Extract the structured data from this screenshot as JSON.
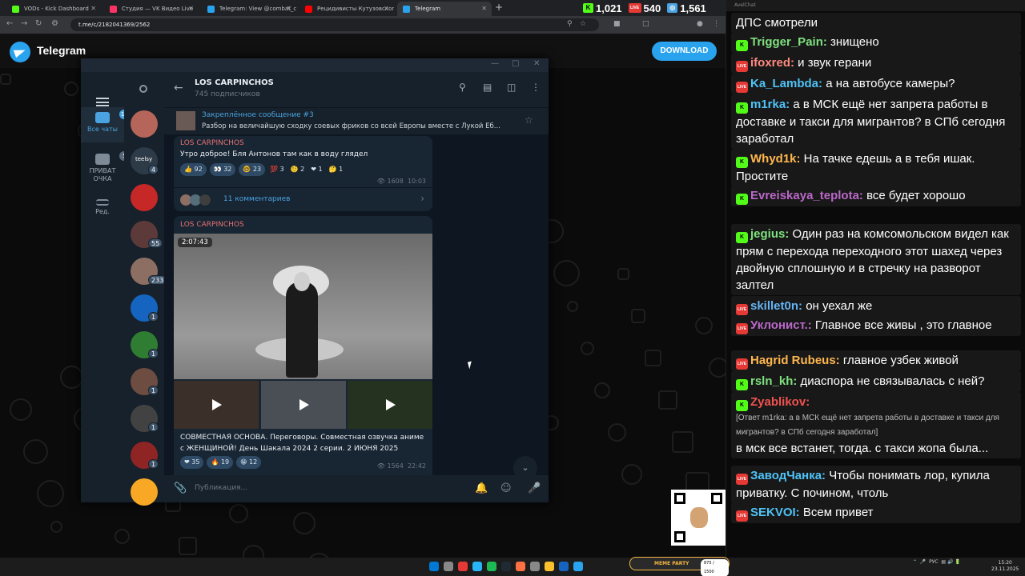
{
  "browser": {
    "tabs": [
      {
        "label": "VODs - Kick Dashboard",
        "color": "#53fc18"
      },
      {
        "label": "Студия — VK Видео Live",
        "color": "#ff3366"
      },
      {
        "label": "Telegram: View @combat_cyperpu",
        "color": "#2aa3ef"
      },
      {
        "label": "Рецидивисты Кутузовского пр...",
        "color": "#ff0000"
      },
      {
        "label": "Telegram",
        "color": "#2aa3ef"
      }
    ],
    "url": "t.me/c/2182041369/2562",
    "new_tab": "+"
  },
  "counters": [
    {
      "icon": "kick-icon",
      "value": "1,021",
      "color": "#53fc18"
    },
    {
      "icon": "live-icon",
      "value": "540",
      "color": "#e53935"
    },
    {
      "icon": "viewers-icon",
      "value": "1,561",
      "color": "#4aa3e0"
    }
  ],
  "telegram": {
    "brand": "Telegram",
    "download": "DOWNLOAD",
    "folders": [
      {
        "label": "Все чаты",
        "badge": "12"
      },
      {
        "label": "ПРИВАТ ОЧКА",
        "badge": "5"
      },
      {
        "label": "Ред.",
        "badge": ""
      }
    ],
    "chat_badges": [
      "4",
      "",
      "55",
      "233",
      "1",
      "1",
      "1",
      "1",
      "1"
    ],
    "avatar_caption": "teelsy",
    "channel": {
      "name": "LOS CARPINCHOS",
      "subs": "745 подписчиков"
    },
    "pinned": {
      "title": "Закреплённое сообщение #3",
      "text": "Разбор на величайшую сходку соевых фриков со всей Европы вместе с Лукой Еб..."
    },
    "msg1": {
      "author": "LOS CARPINCHOS",
      "text": "Утро доброе! Бля Антонов там как в воду глядел",
      "reactions": [
        "👍 92",
        "👀 32",
        "🤓 23",
        "💯 3",
        "🤨 2",
        "❤ 1",
        "🤔 1"
      ],
      "views": "1608",
      "time": "10:03",
      "comments": "11 комментариев"
    },
    "msg2": {
      "author": "LOS CARPINCHOS",
      "duration": "2:07:43",
      "text": "СОВМЕСТНАЯ ОСНОВА. Переговоры. Совместная озвучка аниме с ЖЕНЩИНОЙ! День Шакала 2024 2 серии. 2 ИЮНЯ 2025",
      "reactions": [
        "❤ 35",
        "🔥 19",
        "😁 12"
      ],
      "views": "1564",
      "time": "22:42"
    },
    "composer_placeholder": "Публикация..."
  },
  "chat_panel": {
    "title": "AvelChat",
    "messages": [
      {
        "badge": "",
        "user": "",
        "color": "#ffffff",
        "text": "ДПС смотрели"
      },
      {
        "badge": "kick",
        "user": "Trigger_Pain:",
        "color": "#7ee07e",
        "text": " знищено"
      },
      {
        "badge": "live",
        "user": "ifoxred:",
        "color": "#ff8a80",
        "text": " и звук герани"
      },
      {
        "badge": "live",
        "user": "Ka_Lambda:",
        "color": "#4fc3f7",
        "text": " а на автобусе камеры?"
      },
      {
        "badge": "kick",
        "user": "m1rka:",
        "color": "#4fc3f7",
        "text": " а в МСК ещё нет запрета работы в доставке и такси для мигрантов? в СПб сегодня заработал"
      },
      {
        "badge": "kick",
        "user": "Whyd1k:",
        "color": "#ffb74d",
        "text": " На тачке едешь а в тебя ишак. Простите"
      },
      {
        "badge": "kick",
        "user": "Evreiskaya_teplota:",
        "color": "#ba68c8",
        "text": " все будет хорошо"
      },
      {
        "badge": "kick",
        "user": "jegius:",
        "color": "#7ee07e",
        "text": " Один раз на комсомольском видел как прям с перехода переходного этот шахед через двойную сплошную и в стречку на разворот залтел"
      },
      {
        "badge": "live",
        "user": "skillet0n:",
        "color": "#64b5f6",
        "text": " он уехал же"
      },
      {
        "badge": "live",
        "user": "Уклонист.:",
        "color": "#ba68c8",
        "text": " Главное все живы , это главное"
      },
      {
        "badge": "live",
        "user": "Hagrid Rubeus:",
        "color": "#ffb74d",
        "text": " главное узбек живой"
      },
      {
        "badge": "kick",
        "user": "rsln_kh:",
        "color": "#7ee07e",
        "text": " диаспора не связывалась с ней?"
      },
      {
        "badge": "kick",
        "user": "Zyablikov:",
        "color": "#ef5350",
        "text": "",
        "reply": "[Ответ m1rka: а в МСК ещё нет запрета работы в доставке и такси для мигрантов? в СПб сегодня заработал]",
        "after": "в мск все встанет, тогда. с такси жопа была..."
      },
      {
        "badge": "live",
        "user": "ЗаводЧанка:",
        "color": "#4fc3f7",
        "text": " Чтобы понимать лор, купила приватку. С почином, чтоль"
      },
      {
        "badge": "live",
        "user": "SEKVOI:",
        "color": "#4fc3f7",
        "text": " Всем привет"
      }
    ]
  },
  "taskbar": {
    "meme_label": "MEME PARTY",
    "meme_value": "875 / 1500",
    "lang": "РУС",
    "time": "15:20",
    "date": "23.11.2025"
  }
}
